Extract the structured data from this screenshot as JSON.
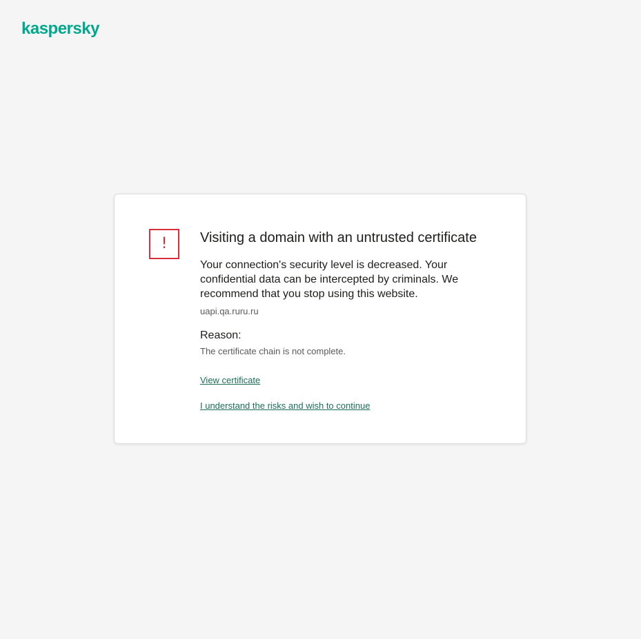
{
  "brand": {
    "logo_text": "kaspersky",
    "accent_color": "#00a88e"
  },
  "warning": {
    "icon": "exclamation-icon",
    "icon_glyph": "!",
    "icon_color": "#d92f3d",
    "title": "Visiting a domain with an untrusted certificate",
    "description": "Your connection's security level is decreased. Your confidential data can be intercepted by criminals. We recommend that you stop using this website.",
    "domain": "uapi.qa.ruru.ru",
    "reason_label": "Reason:",
    "reason_text": "The certificate chain is not complete.",
    "view_certificate_link": "View certificate",
    "continue_link": "I understand the risks and wish to continue"
  }
}
